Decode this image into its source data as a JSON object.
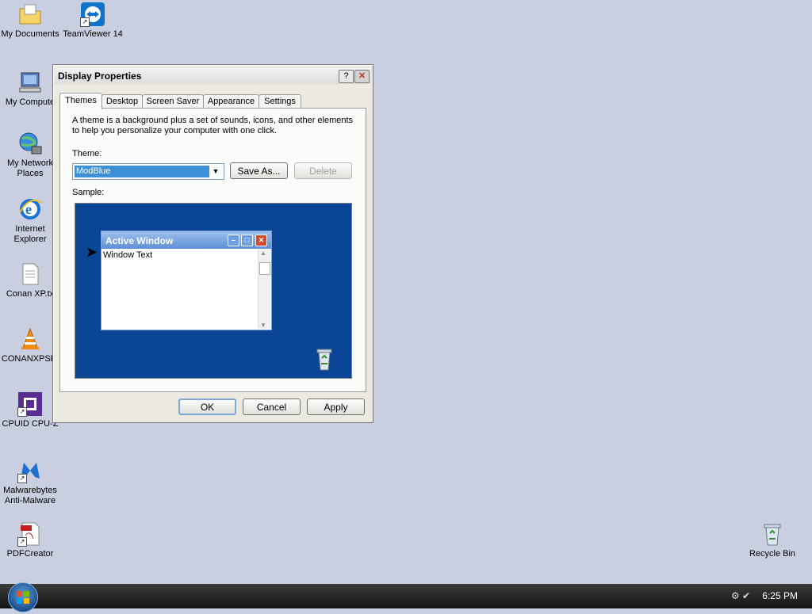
{
  "desktop": {
    "icons": [
      {
        "label": "My Documents"
      },
      {
        "label": "TeamViewer 14"
      },
      {
        "label": "My Compute"
      },
      {
        "label": "My Network\nPlaces"
      },
      {
        "label": "Internet\nExplorer"
      },
      {
        "label": "Conan XP.tx"
      },
      {
        "label": "CONANXPSE."
      },
      {
        "label": "CPUID CPU-Z"
      },
      {
        "label": "Malwarebytes\nAnti-Malware"
      },
      {
        "label": "PDFCreator"
      },
      {
        "label": "Recycle Bin"
      }
    ]
  },
  "dialog": {
    "title": "Display Properties",
    "help_btn": "?",
    "close_btn": "✕",
    "tabs": [
      "Themes",
      "Desktop",
      "Screen Saver",
      "Appearance",
      "Settings"
    ],
    "description": "A theme is a background plus a set of sounds, icons, and other elements to help you personalize your computer with one click.",
    "theme_label": "Theme:",
    "theme_value": "ModBlue",
    "save_as": "Save As...",
    "delete": "Delete",
    "sample_label": "Sample:",
    "sample": {
      "window_title": "Active Window",
      "window_text": "Window Text"
    },
    "ok": "OK",
    "cancel": "Cancel",
    "apply": "Apply"
  },
  "taskbar": {
    "clock": "6:25 PM"
  }
}
